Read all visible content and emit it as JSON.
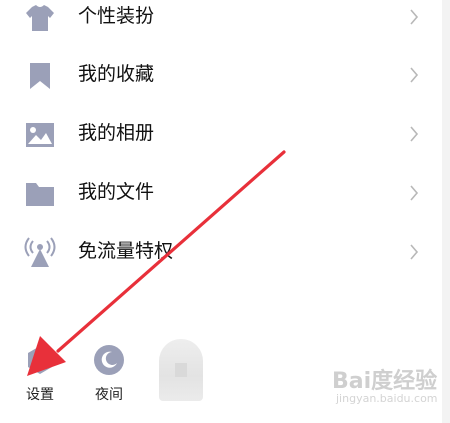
{
  "menu": {
    "items": [
      {
        "label": "个性装扮",
        "icon": "shirt-icon"
      },
      {
        "label": "我的收藏",
        "icon": "bookmark-icon"
      },
      {
        "label": "我的相册",
        "icon": "image-icon"
      },
      {
        "label": "我的文件",
        "icon": "folder-icon"
      },
      {
        "label": "免流量特权",
        "icon": "signal-tower-icon"
      }
    ],
    "chevron": "chevron-right-icon"
  },
  "bottom_bar": {
    "settings_label": "设置",
    "night_label": "夜间"
  },
  "watermark": {
    "text": "Bai度经验",
    "url": "jingyan.baidu.com"
  },
  "colors": {
    "icon_gray": "#9ba0b8",
    "arrow_red": "#e8303a",
    "text": "#111111",
    "chevron": "#b8b8b8"
  }
}
